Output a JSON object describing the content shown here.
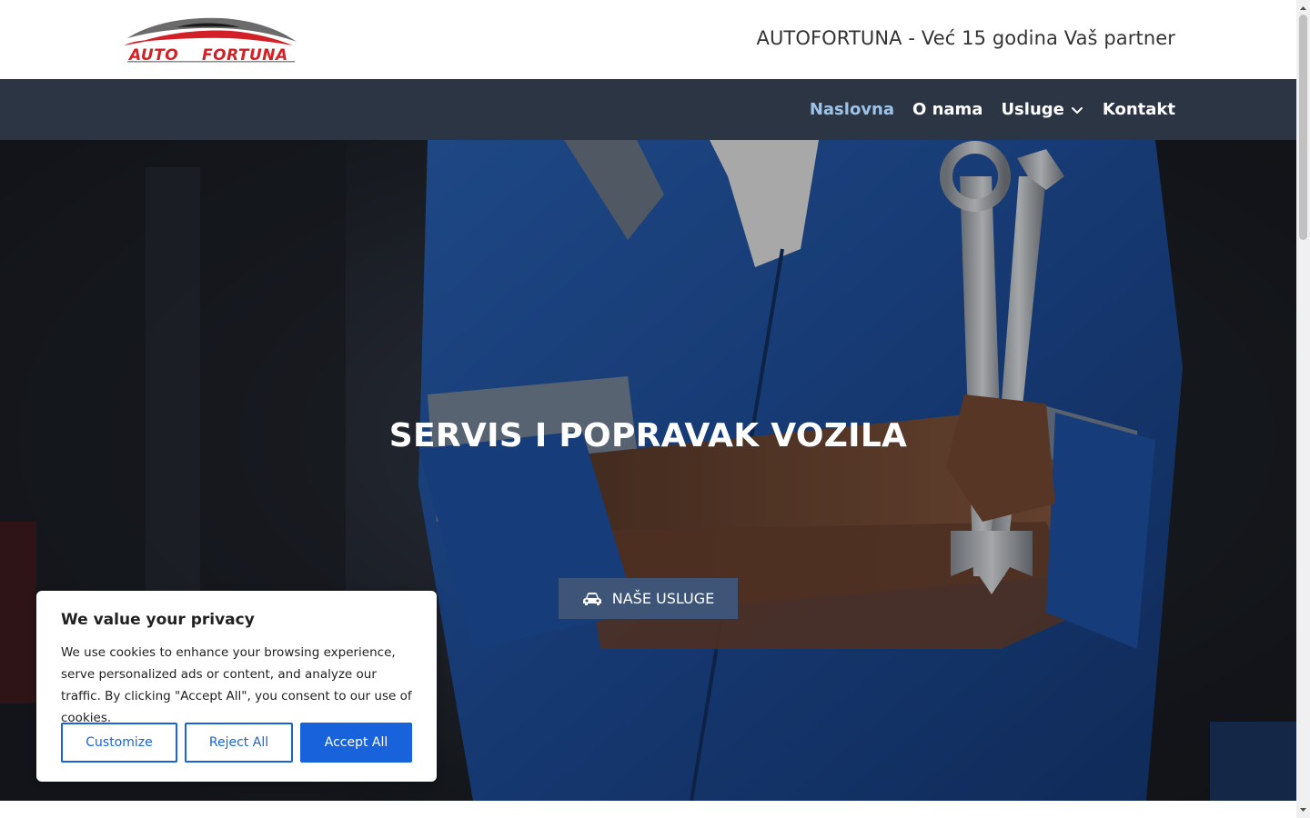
{
  "header": {
    "logo_text": "AUTO FORTUNA",
    "tagline": "AUTOFORTUNA - Već 15 godina Vaš partner"
  },
  "nav": {
    "items": [
      {
        "label": "Naslovna",
        "active": true
      },
      {
        "label": "O nama",
        "active": false
      },
      {
        "label": "Usluge",
        "active": false,
        "has_dropdown": true,
        "icon": "chevron-down-icon"
      },
      {
        "label": "Kontakt",
        "active": false
      }
    ]
  },
  "hero": {
    "title": "SERVIS I POPRAVAK VOZILA",
    "button_label": "NAŠE USLUGE",
    "button_icon": "car-icon"
  },
  "cookie_banner": {
    "title": "We value your privacy",
    "text": "We use cookies to enhance your browsing experience, serve personalized ads or content, and analyze our traffic. By clicking \"Accept All\", you consent to our use of cookies.",
    "customize_label": "Customize",
    "reject_label": "Reject All",
    "accept_label": "Accept All"
  },
  "colors": {
    "nav_bg": "#2b3544",
    "nav_active": "#9ec3e6",
    "hero_button_bg": "#3f5577",
    "cookie_accent": "#1863dc",
    "logo_red": "#d32027"
  }
}
